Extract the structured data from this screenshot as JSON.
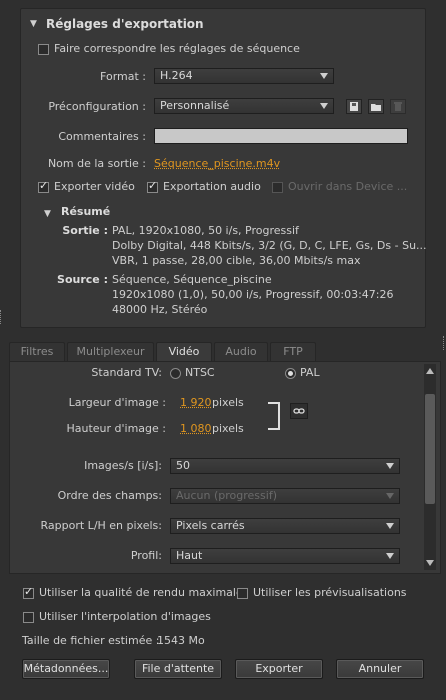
{
  "export_settings": {
    "header": "Réglages d'exportation",
    "match_sequence_label": "Faire correspondre les réglages de séquence",
    "match_sequence_checked": false,
    "format_label": "Format :",
    "format_value": "H.264",
    "preset_label": "Préconfiguration :",
    "preset_value": "Personnalisé",
    "comments_label": "Commentaires :",
    "comments_value": "",
    "output_name_label": "Nom de la sortie :",
    "output_name_value": "Séquence_piscine.m4v",
    "export_video_label": "Exporter vidéo",
    "export_video_checked": true,
    "export_audio_label": "Exportation audio",
    "export_audio_checked": true,
    "open_device_label": "Ouvrir dans Device ...",
    "open_device_checked": false
  },
  "summary": {
    "header": "Résumé",
    "output_label": "Sortie :",
    "output_lines": [
      "PAL, 1920x1080, 50 i/s, Progressif",
      "Dolby Digital, 448 Kbits/s, 3/2 (G, D, C, LFE, Gs, Ds - Su...",
      "VBR, 1 passe, 28,00 cible, 36,00 Mbits/s max"
    ],
    "source_label": "Source :",
    "source_lines": [
      "Séquence, Séquence_piscine",
      "1920x1080 (1,0), 50,00 i/s, Progressif, 00:03:47:26",
      "48000 Hz, Stéréo"
    ]
  },
  "tabs": [
    {
      "label": "Filtres",
      "active": false
    },
    {
      "label": "Multiplexeur",
      "active": false
    },
    {
      "label": "Vidéo",
      "active": true
    },
    {
      "label": "Audio",
      "active": false
    },
    {
      "label": "FTP",
      "active": false
    }
  ],
  "video": {
    "standard_label": "Standard TV:",
    "ntsc_label": "NTSC",
    "pal_label": "PAL",
    "selected_standard": "PAL",
    "width_label": "Largeur d'image :",
    "width_value": "1 920",
    "width_unit": "pixels",
    "height_label": "Hauteur d'image :",
    "height_value": "1 080",
    "height_unit": "pixels",
    "fps_label": "Images/s [i/s]:",
    "fps_value": "50",
    "field_order_label": "Ordre des champs:",
    "field_order_value": "Aucun (progressif)",
    "aspect_label": "Rapport L/H en pixels:",
    "aspect_value": "Pixels carrés",
    "profile_label": "Profil:",
    "profile_value": "Haut"
  },
  "bottom": {
    "max_quality_label": "Utiliser la qualité de rendu maximale",
    "max_quality_checked": true,
    "previews_label": "Utiliser les prévisualisations",
    "previews_checked": false,
    "interp_label": "Utiliser l'interpolation d'images",
    "interp_checked": false,
    "file_size_label": "Taille de fichier estimée :",
    "file_size_value": "1543 Mo"
  },
  "buttons": {
    "metadata": "Métadonnées...",
    "queue": "File d'attente",
    "export": "Exporter",
    "cancel": "Annuler"
  },
  "colors": {
    "background": "#2f2f2f",
    "panel": "#383838",
    "accent_orange": "#e0961f"
  }
}
